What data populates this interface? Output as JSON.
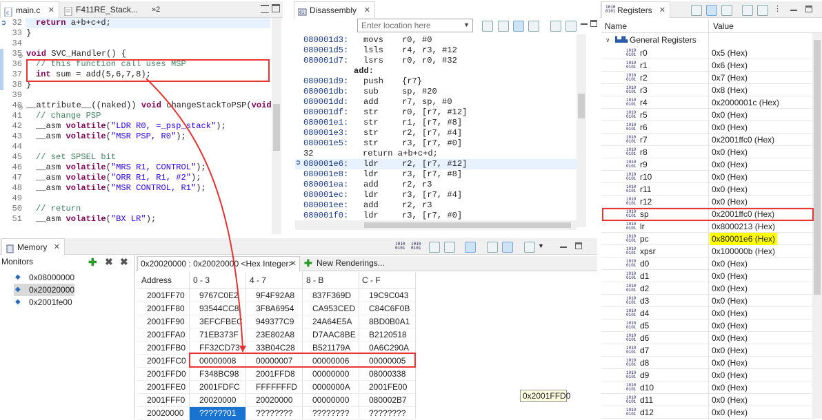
{
  "editor": {
    "tabs": [
      {
        "label": "main.c"
      },
      {
        "label": "F411RE_Stack..."
      },
      {
        "label": "»2"
      }
    ],
    "lines": [
      {
        "num": "32",
        "text": "return a+b+c+d;"
      },
      {
        "num": "33",
        "text": "}"
      },
      {
        "num": "34",
        "text": ""
      },
      {
        "num": "35",
        "text": "void SVC_Handler() {"
      },
      {
        "num": "36",
        "text": "// this function call uses MSP"
      },
      {
        "num": "37",
        "text": "int sum = add(5,6,7,8);"
      },
      {
        "num": "38",
        "text": "}"
      },
      {
        "num": "39",
        "text": ""
      },
      {
        "num": "40",
        "text": "__attribute__((naked)) void changeStackToPSP(void)"
      },
      {
        "num": "41",
        "text": "// change PSP"
      },
      {
        "num": "42",
        "text": "__asm volatile(\"LDR R0, =_psp_stack\");"
      },
      {
        "num": "43",
        "text": "__asm volatile(\"MSR PSP, R0\");"
      },
      {
        "num": "44",
        "text": ""
      },
      {
        "num": "45",
        "text": "// set SPSEL bit"
      },
      {
        "num": "46",
        "text": "__asm volatile(\"MRS R1, CONTROL\");"
      },
      {
        "num": "47",
        "text": "__asm volatile(\"ORR R1, R1, #2\");"
      },
      {
        "num": "48",
        "text": "__asm volatile(\"MSR CONTROL, R1\");"
      },
      {
        "num": "49",
        "text": ""
      },
      {
        "num": "50",
        "text": "// return"
      },
      {
        "num": "51",
        "text": "__asm volatile(\"BX LR\");"
      }
    ]
  },
  "disassembly": {
    "tab_label": "Disassembly",
    "location_placeholder": "Enter location here",
    "rows": [
      {
        "addr": "080001d3:",
        "op": "movs",
        "args": "r0, #0"
      },
      {
        "addr": "080001d5:",
        "op": "lsls",
        "args": "r4, r3, #12"
      },
      {
        "addr": "080001d7:",
        "op": "lsrs",
        "args": "r0, r0, #32"
      },
      {
        "addr": "add:",
        "op": "",
        "args": ""
      },
      {
        "addr": "080001d9:",
        "op": "push",
        "args": "{r7}"
      },
      {
        "addr": "080001db:",
        "op": "sub",
        "args": "sp, #20"
      },
      {
        "addr": "080001dd:",
        "op": "add",
        "args": "r7, sp, #0"
      },
      {
        "addr": "080001df:",
        "op": "str",
        "args": "r0, [r7, #12]"
      },
      {
        "addr": "080001e1:",
        "op": "str",
        "args": "r1, [r7, #8]"
      },
      {
        "addr": "080001e3:",
        "op": "str",
        "args": "r2, [r7, #4]"
      },
      {
        "addr": "080001e5:",
        "op": "str",
        "args": "r3, [r7, #0]"
      },
      {
        "addr": "32",
        "op": "return a+b+c+d;",
        "args": ""
      },
      {
        "addr": "080001e6:",
        "op": "ldr",
        "args": "r2, [r7, #12]"
      },
      {
        "addr": "080001e8:",
        "op": "ldr",
        "args": "r3, [r7, #8]"
      },
      {
        "addr": "080001ea:",
        "op": "add",
        "args": "r2, r3"
      },
      {
        "addr": "080001ec:",
        "op": "ldr",
        "args": "r3, [r7, #4]"
      },
      {
        "addr": "080001ee:",
        "op": "add",
        "args": "r2, r3"
      },
      {
        "addr": "080001f0:",
        "op": "ldr",
        "args": "r3, [r7, #0]"
      }
    ]
  },
  "registers": {
    "tab_label": "Registers",
    "col_name": "Name",
    "col_value": "Value",
    "group": "General Registers",
    "rows": [
      {
        "name": "r0",
        "value": "0x5 (Hex)"
      },
      {
        "name": "r1",
        "value": "0x6 (Hex)"
      },
      {
        "name": "r2",
        "value": "0x7 (Hex)"
      },
      {
        "name": "r3",
        "value": "0x8 (Hex)"
      },
      {
        "name": "r4",
        "value": "0x2000001c (Hex)"
      },
      {
        "name": "r5",
        "value": "0x0 (Hex)"
      },
      {
        "name": "r6",
        "value": "0x0 (Hex)"
      },
      {
        "name": "r7",
        "value": "0x2001ffc0 (Hex)"
      },
      {
        "name": "r8",
        "value": "0x0 (Hex)"
      },
      {
        "name": "r9",
        "value": "0x0 (Hex)"
      },
      {
        "name": "r10",
        "value": "0x0 (Hex)"
      },
      {
        "name": "r11",
        "value": "0x0 (Hex)"
      },
      {
        "name": "r12",
        "value": "0x0 (Hex)"
      },
      {
        "name": "sp",
        "value": "0x2001ffc0 (Hex)"
      },
      {
        "name": "lr",
        "value": "0x8000213 (Hex)"
      },
      {
        "name": "pc",
        "value": "0x80001e6 (Hex)"
      },
      {
        "name": "xpsr",
        "value": "0x100000b (Hex)"
      },
      {
        "name": "d0",
        "value": "0x0 (Hex)"
      },
      {
        "name": "d1",
        "value": "0x0 (Hex)"
      },
      {
        "name": "d2",
        "value": "0x0 (Hex)"
      },
      {
        "name": "d3",
        "value": "0x0 (Hex)"
      },
      {
        "name": "d4",
        "value": "0x0 (Hex)"
      },
      {
        "name": "d5",
        "value": "0x0 (Hex)"
      },
      {
        "name": "d6",
        "value": "0x0 (Hex)"
      },
      {
        "name": "d7",
        "value": "0x0 (Hex)"
      },
      {
        "name": "d8",
        "value": "0x0 (Hex)"
      },
      {
        "name": "d9",
        "value": "0x0 (Hex)"
      },
      {
        "name": "d10",
        "value": "0x0 (Hex)"
      },
      {
        "name": "d11",
        "value": "0x0 (Hex)"
      },
      {
        "name": "d12",
        "value": "0x0 (Hex)"
      }
    ]
  },
  "memory": {
    "tab_label": "Memory",
    "monitors_label": "Monitors",
    "monitors": [
      "0x08000000",
      "0x20020000",
      "0x2001fe00"
    ],
    "rendering_tab": "0x20020000 : 0x20020000 <Hex Integer>",
    "new_renderings": "New Renderings...",
    "headers": [
      "Address",
      "0 - 3",
      "4 - 7",
      "8 - B",
      "C - F"
    ],
    "rows": [
      [
        "2001FF70",
        "9767C0E2",
        "9F4F92A8",
        "837F369D",
        "19C9C043"
      ],
      [
        "2001FF80",
        "93544CC8",
        "3F8A6954",
        "CA953CED",
        "C84C6F0B"
      ],
      [
        "2001FF90",
        "3EFCFBEC",
        "949377C9",
        "24A64E5A",
        "8BD0B0A1"
      ],
      [
        "2001FFA0",
        "71EB373F",
        "23E802A8",
        "D7AAC8BE",
        "B2120518"
      ],
      [
        "2001FFB0",
        "FF32CD73",
        "33B04C28",
        "B521179A",
        "0A6C290A"
      ],
      [
        "2001FFC0",
        "00000008",
        "00000007",
        "00000006",
        "00000005"
      ],
      [
        "2001FFD0",
        "F348BC98",
        "2001FFD8",
        "00000000",
        "08000338"
      ],
      [
        "2001FFE0",
        "2001FDFC",
        "FFFFFFFD",
        "0000000A",
        "2001FE00"
      ],
      [
        "2001FFF0",
        "20020000",
        "20020000",
        "00000000",
        "080002B7"
      ],
      [
        "20020000",
        "??????01",
        "????????",
        "????????",
        "????????"
      ]
    ],
    "tooltip": "0x2001FFD0"
  },
  "colors": {
    "highlight_pc": "#ffff00",
    "annotation": "#e33333",
    "selection": "#1874d0"
  }
}
